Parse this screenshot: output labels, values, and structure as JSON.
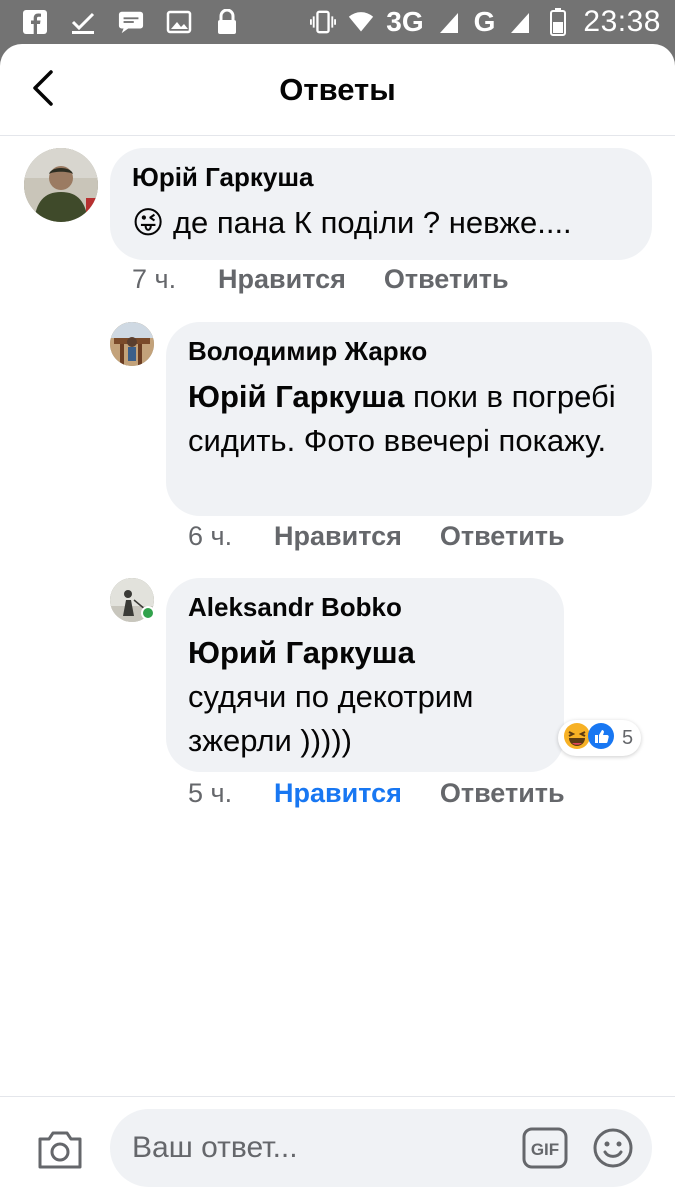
{
  "status_bar": {
    "network_a": "3G",
    "network_b": "G",
    "time": "23:38",
    "icons": [
      "facebook-icon",
      "check-icon",
      "message-icon",
      "image-icon",
      "lock-icon",
      "vibrate-icon",
      "wifi-icon",
      "signal-icon",
      "battery-icon"
    ]
  },
  "header": {
    "title": "Ответы",
    "back_icon": "chevron-left-icon"
  },
  "comments": [
    {
      "author": "Юрій Гаркуша",
      "emoji": "😜",
      "text": "де пана К поділи ? невже....",
      "time": "7 ч.",
      "like": "Нравится",
      "reply": "Ответить"
    },
    {
      "author": "Володимир Жарко",
      "mention": "Юрій Гаркуша",
      "text": " поки в погребі сидить. Фото ввечері покажу.",
      "time": "6 ч.",
      "like": "Нравится",
      "reply": "Ответить"
    },
    {
      "author": "Aleksandr Bobko",
      "mention": "Юрий Гаркуша",
      "text": "судячи по декотрим зжерли )))))",
      "time": "5 ч.",
      "like": "Нравится",
      "reply": "Ответить",
      "liked": true,
      "reaction_count": "5",
      "reaction_icons": [
        "laugh-reaction-icon",
        "like-reaction-icon"
      ]
    }
  ],
  "composer": {
    "placeholder": "Ваш ответ...",
    "gif_label": "GIF",
    "icons": [
      "camera-icon",
      "gif-icon",
      "emoji-icon"
    ]
  },
  "colors": {
    "accent": "#1877f2",
    "bubble": "#f0f2f5",
    "secondary_text": "#65676b",
    "status_bar": "#737373"
  }
}
